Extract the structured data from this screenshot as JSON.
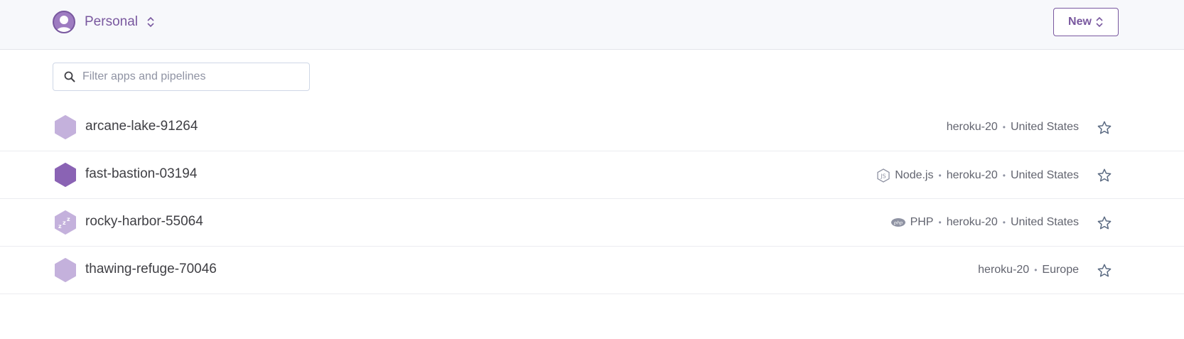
{
  "header": {
    "team_name": "Personal",
    "new_button_label": "New"
  },
  "filter": {
    "placeholder": "Filter apps and pipelines",
    "value": ""
  },
  "colors": {
    "brand_purple": "#79589f",
    "hex_light": "#c4b1dc",
    "hex_dark": "#8a63b4",
    "header_bg": "#f7f8fb"
  },
  "apps": [
    {
      "name": "arcane-lake-91264",
      "icon": "hexagon-icon",
      "language": "",
      "stack": "heroku-20",
      "region": "United States"
    },
    {
      "name": "fast-bastion-03194",
      "icon": "hexagon-icon",
      "language": "Node.js",
      "language_icon": "nodejs-icon",
      "stack": "heroku-20",
      "region": "United States"
    },
    {
      "name": "rocky-harbor-55064",
      "icon": "sleeping-hexagon-icon",
      "language": "PHP",
      "language_icon": "php-icon",
      "stack": "heroku-20",
      "region": "United States"
    },
    {
      "name": "thawing-refuge-70046",
      "icon": "hexagon-icon",
      "language": "",
      "stack": "heroku-20",
      "region": "Europe"
    }
  ]
}
